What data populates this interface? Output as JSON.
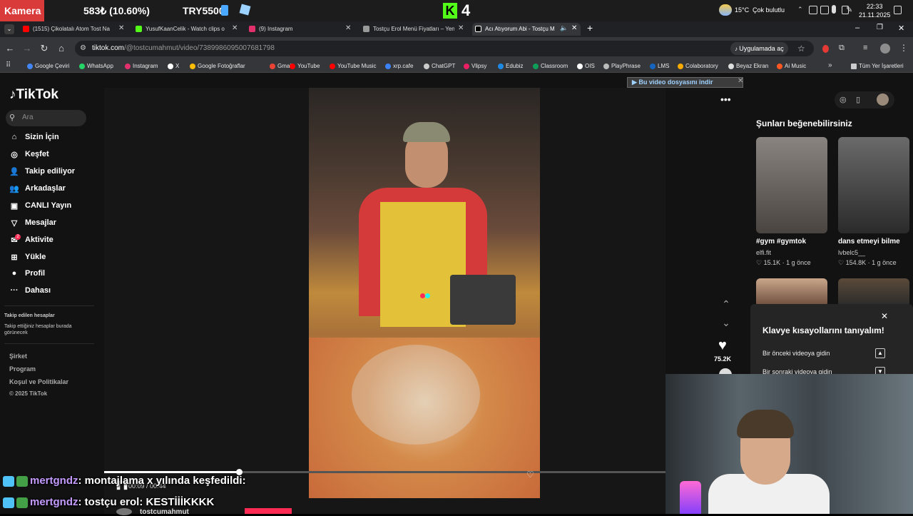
{
  "taskbar": {
    "app_label": "Kamera",
    "ticker_1": "583₺ (10.60%)",
    "ticker_2": "TRY5500",
    "kick_logo": "K",
    "kick_count": "4",
    "weather": "15°C",
    "weather_desc": "Çok bulutlu",
    "time": "22:33",
    "date": "21.11.2025"
  },
  "tabs": [
    {
      "label": "(1515) Çikolatalı Atom Tost Na",
      "color": "#ff0000"
    },
    {
      "label": "YusufKaanCelik - Watch clips o",
      "color": "#53fc18"
    },
    {
      "label": "(9) Instagram",
      "color": "#e1306c"
    },
    {
      "label": "Tostçu Erol Menü Fiyatları – Yen",
      "color": "#999999"
    },
    {
      "label": "Acı Atıyorum Abi - Tostçu M",
      "color": "#000000"
    }
  ],
  "address": {
    "host": "tiktok.com",
    "path": "/@tostcumahmut/video/7389986095007681798",
    "open_app": "Uygulamada aç"
  },
  "bookmarks": [
    {
      "label": "Google Çeviri",
      "color": "#4285f4"
    },
    {
      "label": "WhatsApp",
      "color": "#25d366"
    },
    {
      "label": "Instagram",
      "color": "#e1306c"
    },
    {
      "label": "X",
      "color": "#ffffff"
    },
    {
      "label": "Google Fotoğraflar",
      "color": "#fbbc05"
    },
    {
      "label": "Gmail",
      "color": "#ea4335"
    },
    {
      "label": "YouTube",
      "color": "#ff0000"
    },
    {
      "label": "YouTube Music",
      "color": "#ff0000"
    },
    {
      "label": "xrp.cafe",
      "color": "#3b82f6"
    },
    {
      "label": "ChatGPT",
      "color": "#cccccc"
    },
    {
      "label": "Vlipsy",
      "color": "#e91e63"
    },
    {
      "label": "Edubiz",
      "color": "#1e88e5"
    },
    {
      "label": "Classroom",
      "color": "#0f9d58"
    },
    {
      "label": "OIS",
      "color": "#ffffff"
    },
    {
      "label": "PlayPhrase",
      "color": "#bbbbbb"
    },
    {
      "label": "LMS",
      "color": "#1565c0"
    },
    {
      "label": "Colaboratory",
      "color": "#f9ab00"
    },
    {
      "label": "Beyaz Ekran",
      "color": "#dddddd"
    },
    {
      "label": "Ai Music",
      "color": "#ff5722"
    }
  ],
  "bookmarks_all": "Tüm Yer İşaretleri",
  "tiktok": {
    "logo": "TikTok",
    "search_placeholder": "Ara",
    "nav": [
      {
        "label": "Sizin İçin",
        "icon": "⌂"
      },
      {
        "label": "Keşfet",
        "icon": "◎"
      },
      {
        "label": "Takip ediliyor",
        "icon": "👤"
      },
      {
        "label": "Arkadaşlar",
        "icon": "👥"
      },
      {
        "label": "CANLI Yayın",
        "icon": "▣"
      },
      {
        "label": "Mesajlar",
        "icon": "▽"
      },
      {
        "label": "Aktivite",
        "icon": "✉"
      },
      {
        "label": "Yükle",
        "icon": "⊞"
      },
      {
        "label": "Profil",
        "icon": "●"
      },
      {
        "label": "Dahası",
        "icon": "···"
      }
    ],
    "following_title": "Takip edilen hesaplar",
    "following_sub": "Takip ettiğiniz hesaplar burada görünecek",
    "footer": [
      "Şirket",
      "Program",
      "Koşul ve Politikalar",
      "© 2025 TikTok"
    ],
    "download_banner": "Bu video dosyasını indir",
    "likes": "75.2K",
    "time": "00:09 / 00:44",
    "progress": 0.24,
    "author": "tostcumahmut",
    "suggest_title": "Şunları beğenebilirsiniz",
    "suggestions": [
      {
        "title": "#gym #gymtok",
        "user": "elfi.fit",
        "stats": "♡ 15.1K · 1 g önce"
      },
      {
        "title": "dans etmeyi bilme",
        "user": "lvbelc5__",
        "stats": "♡ 154.8K · 1 g önce"
      }
    ],
    "popup": {
      "title": "Klavye kısayollarını tanıyalım!",
      "rows": [
        {
          "label": "Bir önceki videoya gidin",
          "key": "▲"
        },
        {
          "label": "Bir sonraki videoya gidin",
          "key": "▼"
        }
      ]
    }
  },
  "chat": [
    {
      "user": "mertgndz",
      "message": ": montajlama x yılında keşfedildi:"
    },
    {
      "user": "mertgndz",
      "message": ": tostçu erol: KESTİİİKKKK"
    }
  ]
}
